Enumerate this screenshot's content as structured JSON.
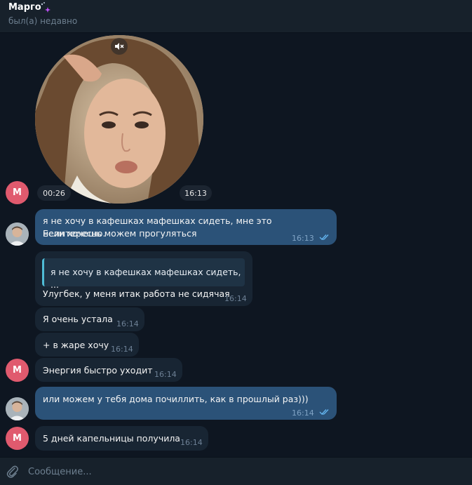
{
  "header": {
    "name": "Марго",
    "status": "был(а) недавно"
  },
  "colors": {
    "background": "#0e1621",
    "header": "#17212b",
    "incoming": "#182533",
    "outgoing": "#2b5278",
    "avatar_m": "#e05a6e",
    "reply_accent": "#4fbcd6"
  },
  "avatar_letter": "М",
  "video_message": {
    "duration": "00:26",
    "time": "16:13",
    "muted": true
  },
  "messages": [
    {
      "dir": "out",
      "lines": [
        "я не хочу в кафешках мафешках сидеть, мне это неинтересно.",
        "Если хочешь можем прогуляться"
      ],
      "time": "16:13",
      "read": true
    },
    {
      "dir": "in",
      "reply": "я не хочу в кафешках мафешках сидеть, ...",
      "text": "Улугбек, у меня итак работа не сидячая",
      "time": "16:14"
    },
    {
      "dir": "in",
      "text": "Я очень устала",
      "time": "16:14"
    },
    {
      "dir": "in",
      "text": "+ в жаре хочу",
      "time": "16:14"
    },
    {
      "dir": "in",
      "text": "Энергия быстро уходит",
      "time": "16:14"
    },
    {
      "dir": "out",
      "text": "или можем у тебя дома почиллить, как в прошлый раз)))",
      "time": "16:14",
      "read": true
    },
    {
      "dir": "in",
      "text": "5 дней капельницы получила",
      "time": "16:14"
    }
  ],
  "composer": {
    "placeholder": "Сообщение..."
  }
}
